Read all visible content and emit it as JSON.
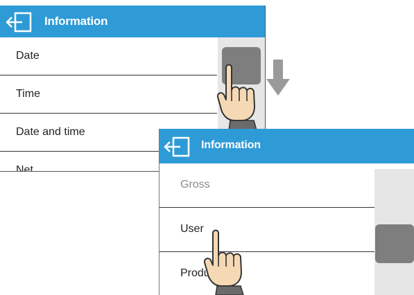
{
  "screens": [
    {
      "header": {
        "title": "Information",
        "back_icon": "back-arrow-icon"
      },
      "items": [
        {
          "label": "Date"
        },
        {
          "label": "Time"
        },
        {
          "label": "Date and time"
        },
        {
          "label": "Net"
        }
      ]
    },
    {
      "header": {
        "title": "Information",
        "back_icon": "back-arrow-icon"
      },
      "items": [
        {
          "label": "Gross"
        },
        {
          "label": "User"
        },
        {
          "label": "Produ"
        }
      ]
    }
  ],
  "gestures": [
    "swipe-down-arrow-icon",
    "hand-pointer-icon"
  ],
  "colors": {
    "header": "#2e9bd6",
    "scroll_thumb": "#7e7e7e",
    "track": "#e6e6e6"
  }
}
